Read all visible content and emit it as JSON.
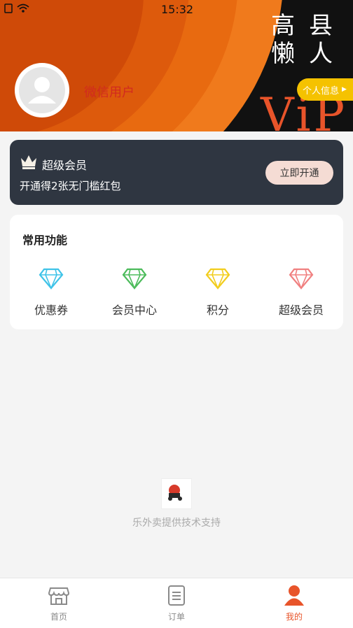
{
  "status_bar": {
    "time": "15:32"
  },
  "header": {
    "username": "微信用户",
    "brand_chars": [
      "高",
      "县",
      "懒",
      "人"
    ],
    "vip_text": "ViP",
    "profile_button": "个人信息"
  },
  "vip_card": {
    "title": "超级会员",
    "description": "开通得2张无门槛红包",
    "button": "立即开通"
  },
  "functions": {
    "title": "常用功能",
    "items": [
      {
        "label": "优惠券",
        "icon": "diamond-icon",
        "color": "#3fc3e8"
      },
      {
        "label": "会员中心",
        "icon": "diamond-icon",
        "color": "#4cbb5b"
      },
      {
        "label": "积分",
        "icon": "diamond-icon",
        "color": "#f2cd1d"
      },
      {
        "label": "超级会员",
        "icon": "diamond-icon",
        "color": "#f08080"
      }
    ]
  },
  "footer": {
    "powered_by": "乐外卖提供技术支持",
    "logo_text": "高县懒人"
  },
  "tabbar": {
    "tabs": [
      {
        "label": "首页",
        "icon": "store-icon"
      },
      {
        "label": "订单",
        "icon": "order-list-icon"
      },
      {
        "label": "我的",
        "icon": "user-icon",
        "active": true
      }
    ]
  },
  "colors": {
    "accent": "#e8542a",
    "vip_card_bg": "#2f3641",
    "profile_btn": "#f5c200"
  }
}
